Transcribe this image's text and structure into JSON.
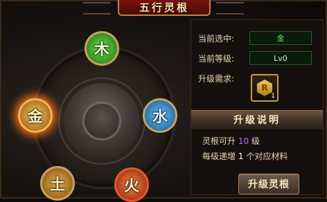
{
  "title": "五行灵根",
  "elements": {
    "wood": "木",
    "water": "水",
    "metal": "金",
    "earth": "土",
    "fire": "火"
  },
  "panel": {
    "current_selected_label": "当前选中:",
    "current_selected_value": "金",
    "current_level_label": "当前等级:",
    "current_level_value": "Lv0",
    "upgrade_requirement_label": "升级需求:",
    "item_count": "1",
    "item_icon": "rune-stone-icon",
    "item_rune_glyph": "R",
    "section_title": "升级说明",
    "desc1_prefix": "灵根可升",
    "desc1_number": "10",
    "desc1_suffix": "级",
    "desc2_prefix": "每级递增",
    "desc2_number": "1",
    "desc2_suffix": "个对应材料",
    "upgrade_button": "升级灵根"
  },
  "colors": {
    "selected_value": "#55f052",
    "level_highlight": "#b36bff"
  }
}
